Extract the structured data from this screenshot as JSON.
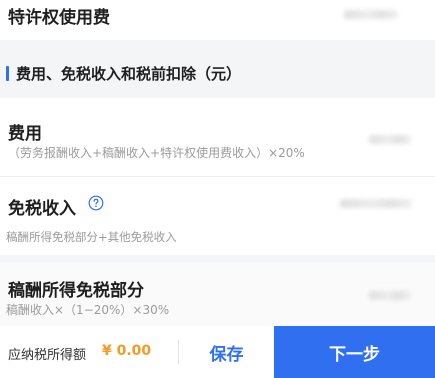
{
  "royalty_row": {
    "title": "特许权使用费"
  },
  "section": {
    "title": "费用、免税收入和税前扣除（元）"
  },
  "expense_row": {
    "title": "费用",
    "formula": "（劳务报酬收入+稿酬收入+特许权使用费收入）×20%"
  },
  "exempt_row": {
    "title": "免税收入",
    "help_icon": "question-circle-icon",
    "description": "稿酬所得免税部分+其他免税收入"
  },
  "manuscript_exempt_row": {
    "title": "稿酬所得免税部分",
    "formula": "稿酬收入×（1−20%）×30%"
  },
  "footer": {
    "taxable_label": "应纳税所得额",
    "taxable_amount": "¥ 0.00",
    "save_label": "保存",
    "next_label": "下一步"
  },
  "colors": {
    "accent": "#2f6ff0",
    "amount": "#f59a23",
    "background": "#f4f5f7"
  }
}
